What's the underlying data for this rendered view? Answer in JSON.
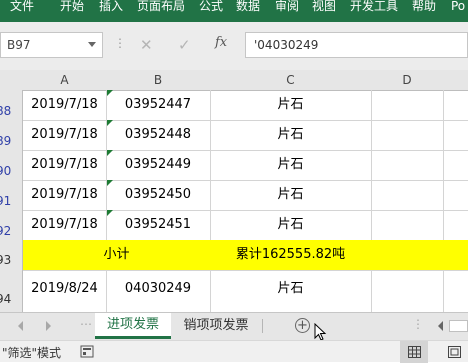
{
  "ribbon": {
    "tabs": [
      "文件",
      "开始",
      "插入",
      "页面布局",
      "公式",
      "数据",
      "审阅",
      "视图",
      "开发工具",
      "帮助",
      "Po"
    ]
  },
  "formula_bar": {
    "name_box": "B97",
    "fx_label": "fx",
    "content": "'04030249"
  },
  "columns": [
    "A",
    "B",
    "C",
    "D"
  ],
  "rows": [
    {
      "num": "88",
      "a": "2019/7/18",
      "b": "03952447",
      "c": "片石"
    },
    {
      "num": "89",
      "a": "2019/7/18",
      "b": "03952448",
      "c": "片石"
    },
    {
      "num": "90",
      "a": "2019/7/18",
      "b": "03952449",
      "c": "片石"
    },
    {
      "num": "91",
      "a": "2019/7/18",
      "b": "03952450",
      "c": "片石"
    },
    {
      "num": "92",
      "a": "2019/7/18",
      "b": "03952451",
      "c": "片石"
    }
  ],
  "subtotal_row": {
    "num": "93",
    "label": "小计",
    "total": "累计162555.82吨"
  },
  "last_row": {
    "num": "94",
    "a": "2019/8/24",
    "b": "04030249",
    "c": "片石"
  },
  "sheet_tabs": [
    "进项发票",
    "销项项发票"
  ],
  "status": {
    "mode": "\"筛选\"模式"
  },
  "colors": {
    "accent": "#217346",
    "highlight": "#ffff00",
    "row_number": "#2f3fa8"
  }
}
